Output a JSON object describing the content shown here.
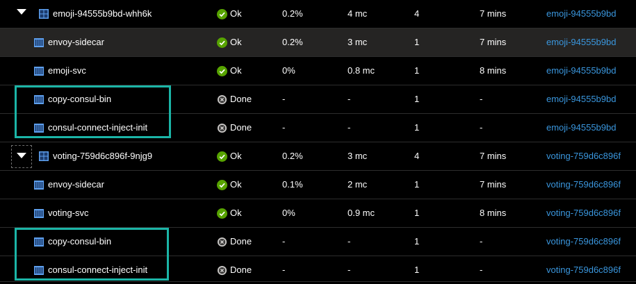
{
  "colors": {
    "ok_green": "#57a300",
    "done_gray": "#a19f9d",
    "link_blue": "#3a96dd",
    "highlight_teal": "#1bb5a7"
  },
  "rows": [
    {
      "name": "emoji-94555b9bd-whh6k",
      "status": "Ok",
      "cpu": "0.2%",
      "cpu_abs": "4 mc",
      "count": "4",
      "uptime": "7 mins",
      "node": "emoji-94555b9bd",
      "icon": "pod-icon",
      "status_icon": "ok-check-icon"
    },
    {
      "name": "envoy-sidecar",
      "status": "Ok",
      "cpu": "0.2%",
      "cpu_abs": "3 mc",
      "count": "1",
      "uptime": "7 mins",
      "node": "emoji-94555b9bd",
      "icon": "container-icon",
      "status_icon": "ok-check-icon"
    },
    {
      "name": "emoji-svc",
      "status": "Ok",
      "cpu": "0%",
      "cpu_abs": "0.8 mc",
      "count": "1",
      "uptime": "8 mins",
      "node": "emoji-94555b9bd",
      "icon": "container-icon",
      "status_icon": "ok-check-icon"
    },
    {
      "name": "copy-consul-bin",
      "status": "Done",
      "cpu": "-",
      "cpu_abs": "-",
      "count": "1",
      "uptime": "-",
      "node": "emoji-94555b9bd",
      "icon": "container-icon",
      "status_icon": "done-icon"
    },
    {
      "name": "consul-connect-inject-init",
      "status": "Done",
      "cpu": "-",
      "cpu_abs": "-",
      "count": "1",
      "uptime": "-",
      "node": "emoji-94555b9bd",
      "icon": "container-icon",
      "status_icon": "done-icon"
    },
    {
      "name": "voting-759d6c896f-9njg9",
      "status": "Ok",
      "cpu": "0.2%",
      "cpu_abs": "3 mc",
      "count": "4",
      "uptime": "7 mins",
      "node": "voting-759d6c896f",
      "icon": "pod-icon",
      "status_icon": "ok-check-icon"
    },
    {
      "name": "envoy-sidecar",
      "status": "Ok",
      "cpu": "0.1%",
      "cpu_abs": "2 mc",
      "count": "1",
      "uptime": "7 mins",
      "node": "voting-759d6c896f",
      "icon": "container-icon",
      "status_icon": "ok-check-icon"
    },
    {
      "name": "voting-svc",
      "status": "Ok",
      "cpu": "0%",
      "cpu_abs": "0.9 mc",
      "count": "1",
      "uptime": "8 mins",
      "node": "voting-759d6c896f",
      "icon": "container-icon",
      "status_icon": "ok-check-icon"
    },
    {
      "name": "copy-consul-bin",
      "status": "Done",
      "cpu": "-",
      "cpu_abs": "-",
      "count": "1",
      "uptime": "-",
      "node": "voting-759d6c896f",
      "icon": "container-icon",
      "status_icon": "done-icon"
    },
    {
      "name": "consul-connect-inject-init",
      "status": "Done",
      "cpu": "-",
      "cpu_abs": "-",
      "count": "1",
      "uptime": "-",
      "node": "voting-759d6c896f",
      "icon": "container-icon",
      "status_icon": "done-icon"
    }
  ]
}
